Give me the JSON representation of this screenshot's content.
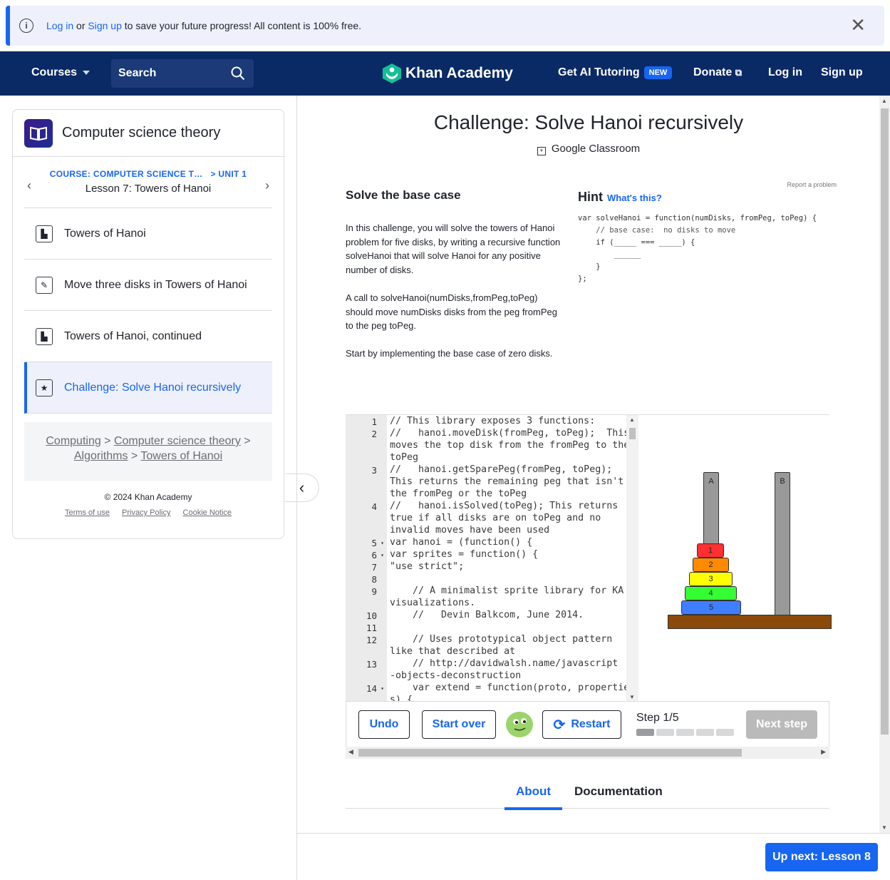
{
  "banner": {
    "login": "Log in",
    "or": " or ",
    "signup": "Sign up",
    "rest": " to save your future progress! All content is 100% free."
  },
  "nav": {
    "courses": "Courses",
    "search_placeholder": "Search",
    "brand": "Khan Academy",
    "ai_tutoring": "Get AI Tutoring",
    "new_badge": "NEW",
    "donate": "Donate",
    "login": "Log in",
    "signup": "Sign up"
  },
  "sidebar": {
    "course_title": "Computer science theory",
    "course_crumb": "COURSE: COMPUTER SCIENCE T…",
    "unit_crumb": "> UNIT 1",
    "lesson_title": "Lesson 7: Towers of Hanoi",
    "items": [
      {
        "label": "Towers of Hanoi",
        "icon": "article-icon"
      },
      {
        "label": "Move three disks in Towers of Hanoi",
        "icon": "pencil-icon"
      },
      {
        "label": "Towers of Hanoi, continued",
        "icon": "article-icon"
      },
      {
        "label": "Challenge: Solve Hanoi recursively",
        "icon": "star-icon"
      }
    ],
    "breadcrumbs": [
      "Computing",
      "Computer science theory",
      "Algorithms",
      "Towers of Hanoi"
    ],
    "copyright": "© 2024 Khan Academy",
    "footer_links": [
      "Terms of use",
      "Privacy Policy",
      "Cookie Notice"
    ]
  },
  "content": {
    "title": "Challenge: Solve Hanoi recursively",
    "google_classroom": "Google Classroom",
    "report": "Report a problem",
    "heading": "Solve the base case",
    "paragraphs": [
      "In this challenge, you will solve the towers of Hanoi problem for five disks, by writing a recursive function solveHanoi that will solve Hanoi for any positive number of disks.",
      "A call to solveHanoi(numDisks,fromPeg,toPeg) should move numDisks disks from the peg fromPeg to the peg toPeg.",
      "Start by implementing the base case of zero disks."
    ],
    "hint_label": "Hint",
    "whats_this": "What's this?",
    "hint_code": [
      "var solveHanoi = function(numDisks, fromPeg, toPeg) {",
      "    // base case:  no disks to move",
      "    if (_____ === _____) {",
      "",
      "        ______",
      "    }",
      "};"
    ]
  },
  "editor": {
    "line_numbers": [
      "1",
      "2",
      "3",
      "4",
      "5",
      "6",
      "7",
      "8",
      "9",
      "10",
      "11",
      "12",
      "13",
      "14"
    ],
    "lines": [
      "// This library exposes 3 functions:",
      "//   hanoi.moveDisk(fromPeg, toPeg);  This",
      "moves the top disk from the fromPeg to the",
      "toPeg",
      "//   hanoi.getSparePeg(fromPeg, toPeg);",
      "This returns the remaining peg that isn't",
      "the fromPeg or the toPeg",
      "//   hanoi.isSolved(toPeg); This returns",
      "true if all disks are on toPeg and no",
      "invalid moves have been used",
      "var hanoi = (function() {",
      "var sprites = function() {",
      "\"use strict\";",
      "",
      "    // A minimalist sprite library for KA",
      "visualizations.",
      "    //   Devin Balkcom, June 2014.",
      "",
      "    // Uses prototypical object pattern",
      "like that described at",
      "    // http://davidwalsh.name/javascript",
      "-objects-deconstruction",
      "    var extend = function(proto, propertie",
      "s) {"
    ]
  },
  "hanoi": {
    "pegs": [
      "A",
      "B"
    ],
    "disks": [
      "1",
      "2",
      "3",
      "4",
      "5"
    ],
    "disk_colors": [
      "#ff3030",
      "#ff8a00",
      "#ffff00",
      "#33ff33",
      "#3f7fff"
    ],
    "peg_color": "#999999",
    "base_color": "#8b4a0a"
  },
  "toolbar": {
    "undo": "Undo",
    "start_over": "Start over",
    "restart": "Restart",
    "step": "Step 1/5",
    "step_current": 1,
    "step_total": 5,
    "next_step": "Next step"
  },
  "tabs": [
    "About",
    "Documentation"
  ],
  "up_next": "Up next: Lesson 8",
  "colors": {
    "accent": "#1865f2",
    "nav": "#0a2a66"
  }
}
